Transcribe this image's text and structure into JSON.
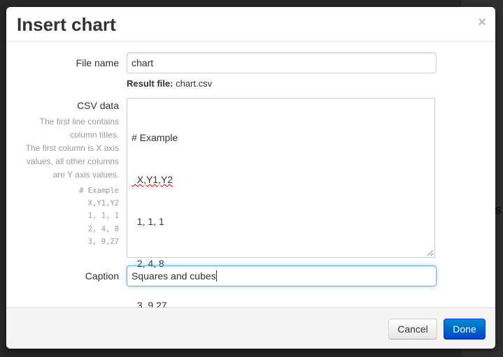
{
  "dialog": {
    "title": "Insert chart",
    "close_glyph": "×"
  },
  "form": {
    "file_name": {
      "label": "File name",
      "value": "chart"
    },
    "result": {
      "label": "Result file:",
      "value": "chart.csv"
    },
    "csv": {
      "label": "CSV data",
      "help": "The first line contains column titles.\nThe first column is X axis values, all other columns are Y axis values.",
      "example": "# Example\nX,Y1,Y2\n1, 1, 1\n2, 4, 8\n3, 9,27",
      "value_lines": [
        "# Example",
        "  X,Y1,Y2",
        "  1, 1, 1",
        "  2, 4, 8",
        "  3, 9,27"
      ]
    },
    "caption": {
      "label": "Caption",
      "value": "Squares and cubes"
    }
  },
  "footer": {
    "cancel_label": "Cancel",
    "done_label": "Done"
  },
  "colors": {
    "primary": "#0066cc",
    "focus_border": "#66afe9",
    "overlay": "#262626"
  }
}
